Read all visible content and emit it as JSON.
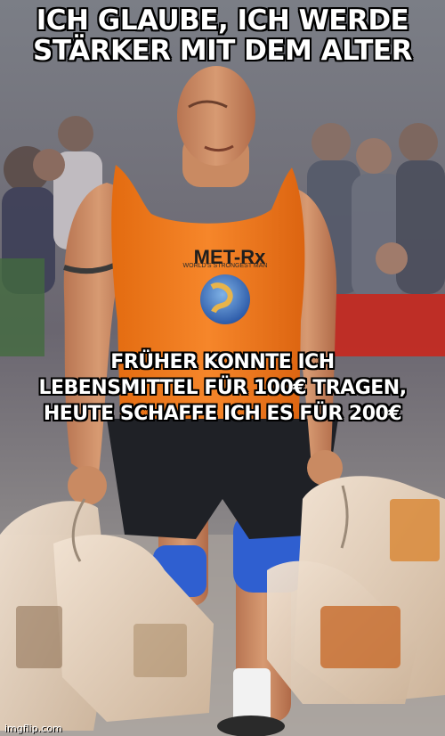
{
  "meme": {
    "top_text_line1": "ICH GLAUBE, ICH WERDE",
    "top_text_line2": "STÄRKER MIT DEM ALTER",
    "bottom_text_line1": "FRÜHER KONNTE ICH",
    "bottom_text_line2": "LEBENSMITTEL FÜR 100€ TRAGEN,",
    "bottom_text_line3": "HEUTE SCHAFFE ICH ES FÜR 200€",
    "watermark": "imgflip.com"
  },
  "shirt": {
    "brand": "MET-Rx",
    "arc_text": "WORLD'S STRONGEST MAN"
  },
  "colors": {
    "shirt": "#f07a1c",
    "knee_sleeve": "#2f5fd0",
    "skin": "#c98a62",
    "bag": "#e9d5bf",
    "crowd": "#6d6a73",
    "banner_red": "#c8281e"
  }
}
